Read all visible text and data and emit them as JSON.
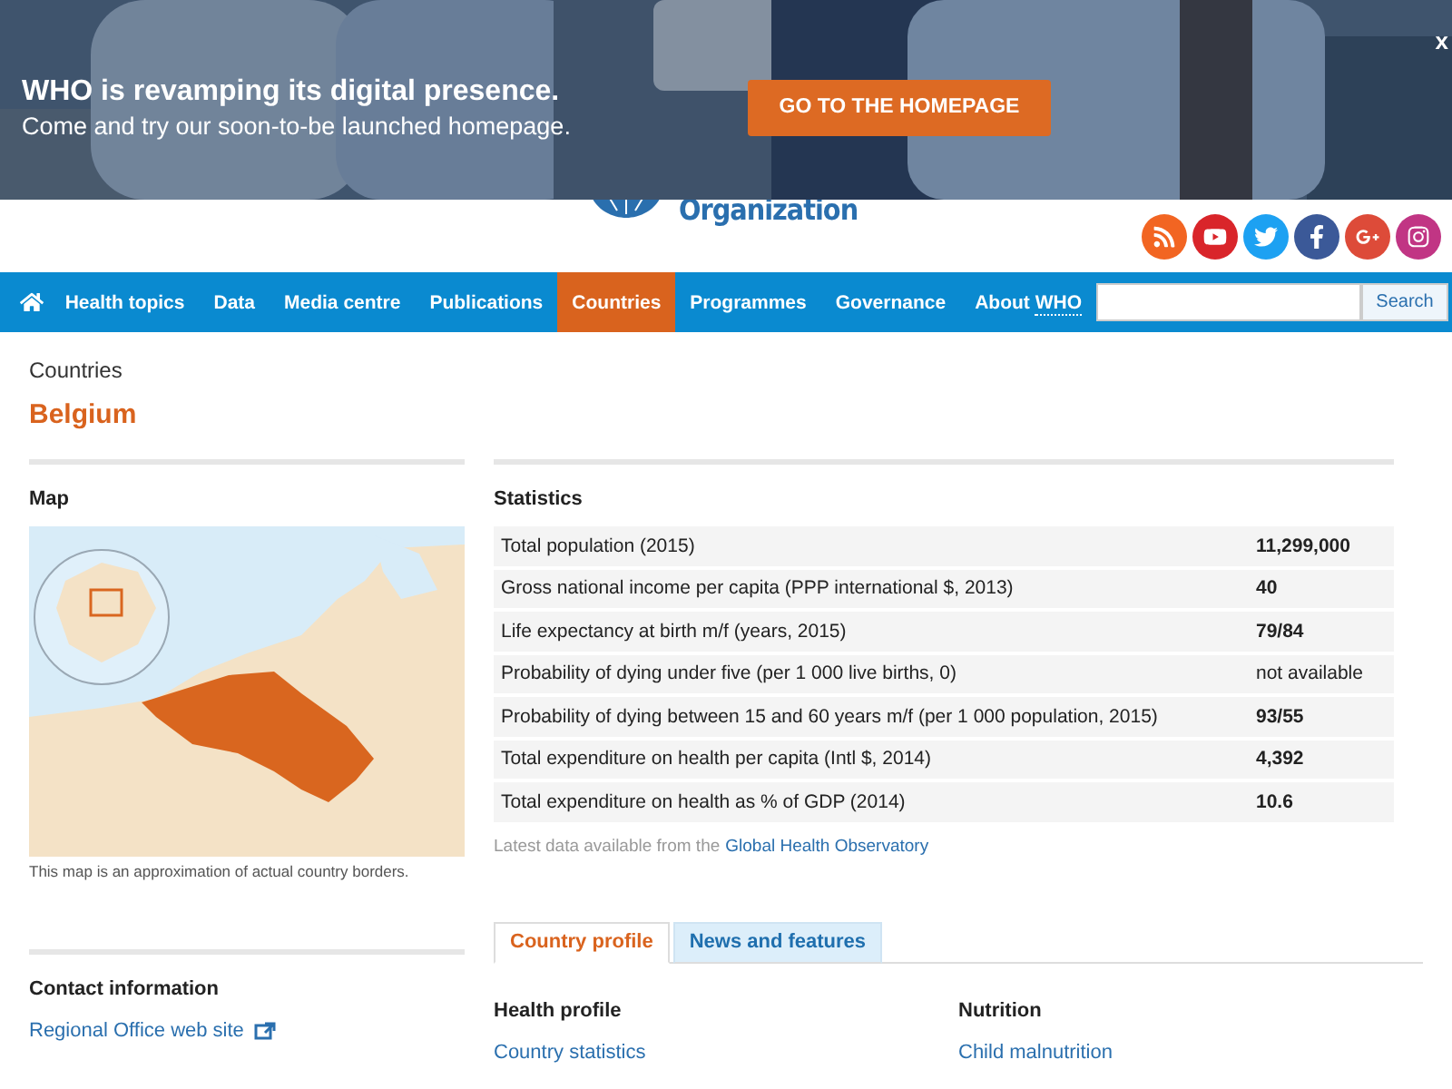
{
  "banner": {
    "title": "WHO is revamping its digital presence.",
    "subtitle": "Come and try our soon-to-be launched homepage.",
    "button": "GO TO THE HOMEPAGE",
    "close": "x"
  },
  "header": {
    "logo_text": "Organization"
  },
  "nav": {
    "items": [
      {
        "label": "Health topics",
        "selected": false
      },
      {
        "label": "Data",
        "selected": false
      },
      {
        "label": "Media centre",
        "selected": false
      },
      {
        "label": "Publications",
        "selected": false
      },
      {
        "label": "Countries",
        "selected": true
      },
      {
        "label": "Programmes",
        "selected": false
      },
      {
        "label": "Governance",
        "selected": false
      },
      {
        "label": "About",
        "abbr": "WHO",
        "selected": false
      }
    ],
    "search_button": "Search"
  },
  "breadcrumb": "Countries",
  "page_title": "Belgium",
  "map": {
    "heading": "Map",
    "caption": "This map is an approximation of actual country borders."
  },
  "contact": {
    "heading": "Contact information",
    "link": "Regional Office web site"
  },
  "statistics": {
    "heading": "Statistics",
    "rows": [
      {
        "label": "Total population (2015)",
        "value": "11,299,000",
        "bold": true
      },
      {
        "label": "Gross national income per capita (PPP international $, 2013)",
        "value": "40",
        "bold": true
      },
      {
        "label": "Life expectancy at birth m/f (years, 2015)",
        "value": "79/84",
        "bold": true
      },
      {
        "label": "Probability of dying under five (per 1 000 live births, 0)",
        "value": "not available",
        "bold": false
      },
      {
        "label": "Probability of dying between 15 and 60 years m/f (per 1 000 population, 2015)",
        "value": "93/55",
        "bold": true
      },
      {
        "label": "Total expenditure on health per capita (Intl $, 2014)",
        "value": "4,392",
        "bold": true
      },
      {
        "label": "Total expenditure on health as % of GDP (2014)",
        "value": "10.6",
        "bold": true
      }
    ],
    "note": "Latest data available from the",
    "note_link": "Global Health Observatory"
  },
  "tabs": [
    {
      "label": "Country profile",
      "selected": true
    },
    {
      "label": "News and features",
      "selected": false
    }
  ],
  "profile_columns": [
    {
      "heading": "Health profile",
      "links": [
        "Country statistics"
      ]
    },
    {
      "heading": "Nutrition",
      "links": [
        "Child malnutrition"
      ]
    }
  ]
}
